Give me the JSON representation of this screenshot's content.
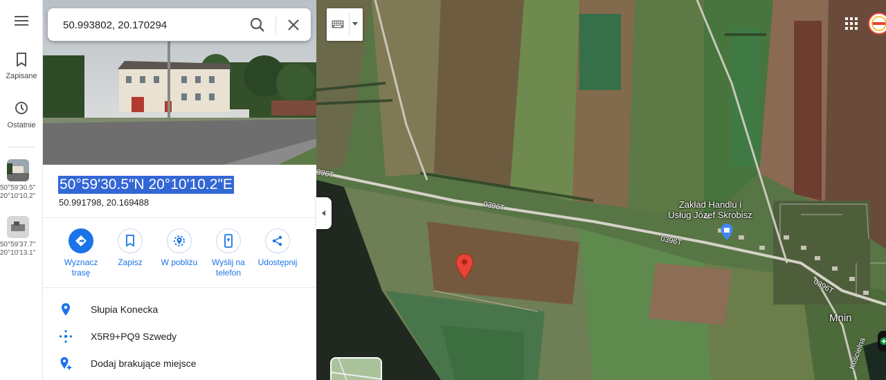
{
  "search": {
    "value": "50.993802, 20.170294"
  },
  "rail": {
    "saved_label": "Zapisane",
    "recent_label": "Ostatnie",
    "history": [
      {
        "coord_line1": "50°59'30.5\"",
        "coord_line2": "20°10'10.2\""
      },
      {
        "coord_line1": "50°59'37.7\"",
        "coord_line2": "20°10'13.1\""
      }
    ]
  },
  "place": {
    "dms": "50°59'30.5\"N 20°10'10.2\"E",
    "decimal": "50.991798, 20.169488"
  },
  "actions": [
    {
      "label": "Wyznacz trasę",
      "icon": "directions-icon"
    },
    {
      "label": "Zapisz",
      "icon": "bookmark-icon"
    },
    {
      "label": "W pobliżu",
      "icon": "nearby-icon"
    },
    {
      "label": "Wyślij na telefon",
      "icon": "send-to-phone-icon"
    },
    {
      "label": "Udostępnij",
      "icon": "share-icon"
    }
  ],
  "info": [
    {
      "text": "Słupia Konecka",
      "icon": "location-pin-icon"
    },
    {
      "text": "X5R9+PQ9 Szwedy",
      "icon": "plus-code-icon"
    },
    {
      "text": "Dodaj brakujące miejsce",
      "icon": "add-place-icon"
    }
  ],
  "map": {
    "poi_line1": "Zakład Handlu i",
    "poi_line2": "Usług Józef Skrobisz",
    "village": "Mnin",
    "road_labels": [
      "396T",
      "0396T",
      "0396T",
      "0396T"
    ],
    "street": "Kościelna",
    "colors": {
      "pin": "#ea4335",
      "accent": "#1a73e8",
      "selection": "#3367d6"
    }
  }
}
